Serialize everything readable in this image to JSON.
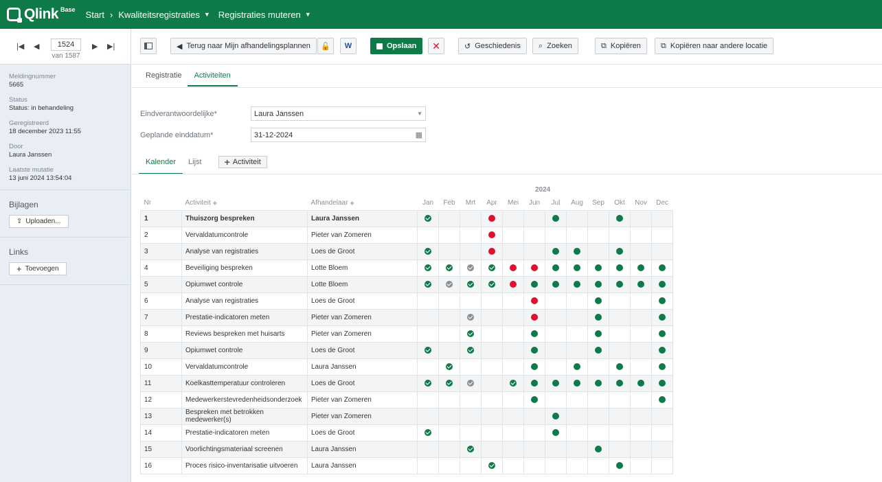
{
  "app": {
    "logo": "Qlink",
    "logo_sup": "Base"
  },
  "nav": {
    "start": "Start",
    "kwaliteit": "Kwaliteitsregistraties",
    "muteren": "Registraties muteren"
  },
  "pager": {
    "current": "1524",
    "total": "van 1587"
  },
  "meta": [
    {
      "label": "Meldingnummer",
      "value": "5665"
    },
    {
      "label": "Status",
      "value": "Status: in behandeling"
    },
    {
      "label": "Geregistreerd",
      "value": "18 december 2023 11:55"
    },
    {
      "label": "Door",
      "value": "Laura Janssen"
    },
    {
      "label": "Laatste mutatie",
      "value": "13 juni 2024 13:54:04"
    }
  ],
  "bijlagen": {
    "title": "Bijlagen",
    "button": "Uploaden..."
  },
  "links": {
    "title": "Links",
    "button": "Toevoegen"
  },
  "toolbar": {
    "back": "Terug naar Mijn afhandelingsplannen",
    "save": "Opslaan",
    "history": "Geschiedenis",
    "search": "Zoeken",
    "copy": "Kopiëren",
    "copy_loc": "Kopiëren naar andere locatie"
  },
  "tabs": {
    "registratie": "Registratie",
    "activiteiten": "Activiteiten"
  },
  "form": {
    "owner_label": "Eindverantwoordelijke*",
    "owner_value": "Laura Janssen",
    "date_label": "Geplande einddatum*",
    "date_value": "31-12-2024"
  },
  "subtabs": {
    "kalender": "Kalender",
    "lijst": "Lijst",
    "add": "Activiteit"
  },
  "table": {
    "year": "2024",
    "headers": {
      "nr": "Nr",
      "activiteit": "Activiteit",
      "afhandelaar": "Afhandelaar"
    },
    "months": [
      "Jan",
      "Feb",
      "Mrt",
      "Apr",
      "Mei",
      "Jun",
      "Jul",
      "Aug",
      "Sep",
      "Okt",
      "Nov",
      "Dec"
    ],
    "rows": [
      {
        "nr": "1",
        "act": "Thuiszorg bespreken",
        "who": "Laura Janssen",
        "m": [
          "cg",
          "",
          "",
          "r",
          "",
          "",
          "g",
          "",
          "",
          "g",
          "",
          ""
        ]
      },
      {
        "nr": "2",
        "act": "Vervaldatumcontrole",
        "who": "Pieter van Zomeren",
        "m": [
          "",
          "",
          "",
          "r",
          "",
          "",
          "",
          "",
          "",
          "",
          "",
          ""
        ]
      },
      {
        "nr": "3",
        "act": "Analyse van registraties",
        "who": "Loes de Groot",
        "m": [
          "cg",
          "",
          "",
          "r",
          "",
          "",
          "g",
          "g",
          "",
          "g",
          "",
          ""
        ]
      },
      {
        "nr": "4",
        "act": "Beveiliging bespreken",
        "who": "Lotte Bloem",
        "m": [
          "cg",
          "cg",
          "cy",
          "cg",
          "r",
          "r",
          "g",
          "g",
          "g",
          "g",
          "g",
          "g"
        ]
      },
      {
        "nr": "5",
        "act": "Opiumwet controle",
        "who": "Lotte Bloem",
        "m": [
          "cg",
          "cy",
          "cg",
          "cg",
          "r",
          "g",
          "g",
          "g",
          "g",
          "g",
          "g",
          "g"
        ]
      },
      {
        "nr": "6",
        "act": "Analyse van registraties",
        "who": "Loes de Groot",
        "m": [
          "",
          "",
          "",
          "",
          "",
          "r",
          "",
          "",
          "g",
          "",
          "",
          "g"
        ]
      },
      {
        "nr": "7",
        "act": "Prestatie-indicatoren meten",
        "who": "Pieter van Zomeren",
        "m": [
          "",
          "",
          "cy",
          "",
          "",
          "r",
          "",
          "",
          "g",
          "",
          "",
          "g"
        ]
      },
      {
        "nr": "8",
        "act": "Reviews bespreken met huisarts",
        "who": "Pieter van Zomeren",
        "m": [
          "",
          "",
          "cg",
          "",
          "",
          "g",
          "",
          "",
          "g",
          "",
          "",
          "g"
        ]
      },
      {
        "nr": "9",
        "act": "Opiumwet controle",
        "who": "Loes de Groot",
        "m": [
          "cg",
          "",
          "cg",
          "",
          "",
          "g",
          "",
          "",
          "g",
          "",
          "",
          "g"
        ]
      },
      {
        "nr": "10",
        "act": "Vervaldatumcontrole",
        "who": "Laura Janssen",
        "m": [
          "",
          "cg",
          "",
          "",
          "",
          "g",
          "",
          "g",
          "",
          "g",
          "",
          "g"
        ]
      },
      {
        "nr": "11",
        "act": "Koelkasttemperatuur controleren",
        "who": "Loes de Groot",
        "m": [
          "cg",
          "cg",
          "cy",
          "",
          "cg",
          "g",
          "g",
          "g",
          "g",
          "g",
          "g",
          "g"
        ]
      },
      {
        "nr": "12",
        "act": "Medewerkerstevredenheidsonderzoek",
        "who": "Pieter van Zomeren",
        "m": [
          "",
          "",
          "",
          "",
          "",
          "g",
          "",
          "",
          "",
          "",
          "",
          "g"
        ]
      },
      {
        "nr": "13",
        "act": "Bespreken met betrokken medewerker(s)",
        "who": "Pieter van Zomeren",
        "m": [
          "",
          "",
          "",
          "",
          "",
          "",
          "g",
          "",
          "",
          "",
          "",
          ""
        ]
      },
      {
        "nr": "14",
        "act": "Prestatie-indicatoren meten",
        "who": "Loes de Groot",
        "m": [
          "cg",
          "",
          "",
          "",
          "",
          "",
          "g",
          "",
          "",
          "",
          "",
          ""
        ]
      },
      {
        "nr": "15",
        "act": "Voorlichtingsmateriaal screenen",
        "who": "Laura Janssen",
        "m": [
          "",
          "",
          "cg",
          "",
          "",
          "",
          "",
          "",
          "g",
          "",
          "",
          ""
        ]
      },
      {
        "nr": "16",
        "act": "Proces risico-inventarisatie uitvoeren",
        "who": "Laura Janssen",
        "m": [
          "",
          "",
          "",
          "cg",
          "",
          "",
          "",
          "",
          "",
          "g",
          "",
          ""
        ]
      }
    ]
  }
}
